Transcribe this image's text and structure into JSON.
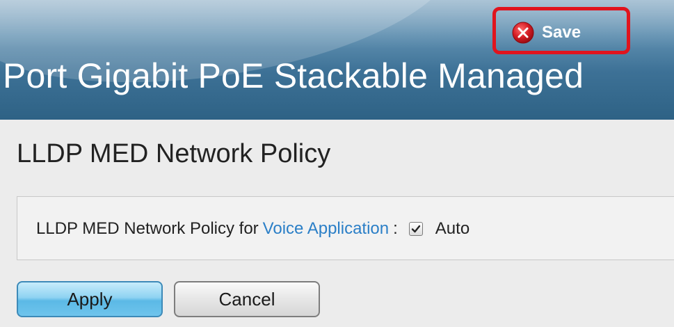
{
  "header": {
    "title": "Port Gigabit PoE Stackable Managed",
    "save_label": "Save",
    "save_icon": "close-circle-icon",
    "highlight_color": "#e0141e"
  },
  "page": {
    "title": "LLDP MED Network Policy"
  },
  "policy": {
    "label_prefix": "LLDP MED Network Policy for",
    "link_text": "Voice Application",
    "separator": ":",
    "auto_checked": true,
    "auto_label": "Auto",
    "link_color": "#2b7fc7"
  },
  "buttons": {
    "apply_label": "Apply",
    "cancel_label": "Cancel"
  }
}
